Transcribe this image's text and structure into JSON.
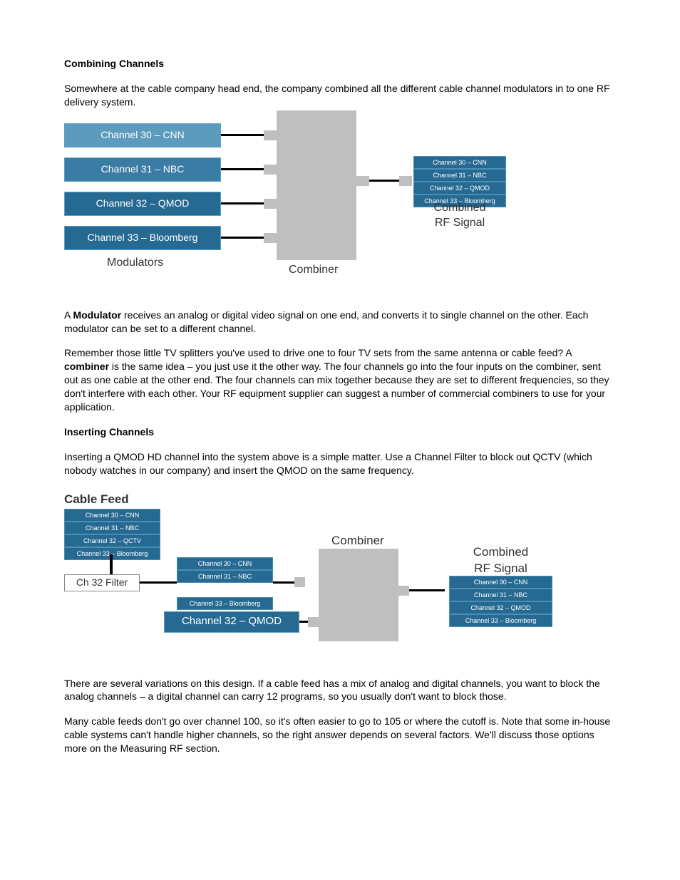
{
  "section1": {
    "heading": "Combining Channels",
    "para1": "Somewhere at the cable company head end, the company combined all the different cable channel modulators in to one RF delivery system."
  },
  "diagram1": {
    "mods": [
      "Channel 30 – CNN",
      "Channel 31 – NBC",
      "Channel 32 – QMOD",
      "Channel 33 – Bloomberg"
    ],
    "mods_label": "Modulators",
    "combiner_label": "Combiner",
    "out_list": [
      "Channel 30 – CNN",
      "Channel 31 – NBC",
      "Channel 32 – QMOD",
      "Channel 33 – Bloomberg"
    ],
    "out_label1": "Combined",
    "out_label2": "RF Signal"
  },
  "section1b": {
    "para2a": "A ",
    "para2b": "Modulator",
    "para2c": " receives an analog or digital video signal on one end, and converts it to single channel on the other. Each modulator can be set to a different channel.",
    "para3a": "Remember those little TV splitters you've used to drive one to four TV sets from the same antenna or cable feed? A ",
    "para3b": "combiner",
    "para3c": " is the same idea – you just use it the other way. The four channels go into the four inputs on the combiner, sent out as one cable at the other end. The four channels can mix together because they are set to different frequencies, so they don't interfere with each other. Your RF equipment supplier can suggest a number of commercial combiners to use for your application."
  },
  "section2": {
    "heading": "Inserting Channels",
    "para1": "Inserting a QMOD HD channel into the system above is a simple matter. Use a Channel Filter to block out QCTV (which nobody watches in our company) and insert the QMOD on the same frequency."
  },
  "diagram2": {
    "cable_feed_label": "Cable Feed",
    "feed_list": [
      "Channel 30 – CNN",
      "Channel 31 – NBC",
      "Channel 32 – QCTV",
      "Channel 33 – Bloomberg"
    ],
    "filter_label": "Ch 32 Filter",
    "filtered_list": [
      "Channel 30 – CNN",
      "Channel 31 – NBC",
      "Channel 33 – Bloomberg"
    ],
    "qmod_box": "Channel 32 – QMOD",
    "combiner_label": "Combiner",
    "out_list": [
      "Channel 30 – CNN",
      "Channel 31 – NBC",
      "Channel 32 – QMOD",
      "Channel 33 – Bloomberg"
    ],
    "out_label1": "Combined",
    "out_label2": "RF Signal"
  },
  "section2b": {
    "para2": "There are several variations on this design. If a cable feed has a mix of analog and digital channels, you want to block the analog channels – a digital channel can carry 12 programs, so you usually don't want to block those.",
    "para3": "Many cable feeds don't go over channel 100, so it's often easier to go to 105 or where the cutoff is. Note that some in-house cable systems can't handle higher channels, so the right answer depends on several factors. We'll discuss those options more on the Measuring RF section."
  }
}
